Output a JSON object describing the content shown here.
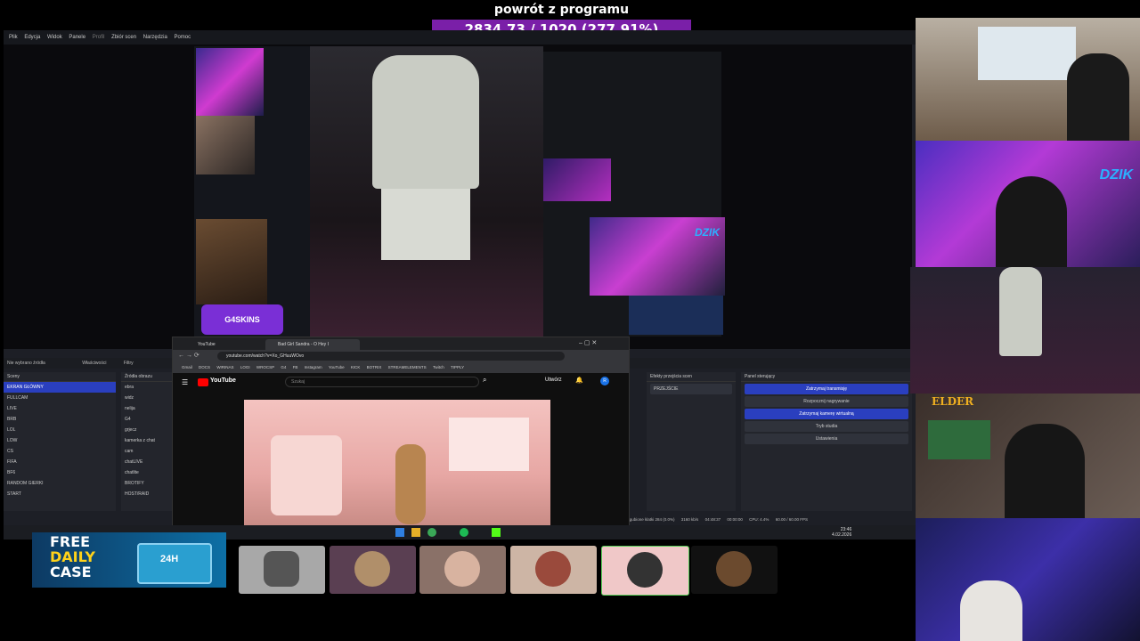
{
  "overlay": {
    "title": "powrót z programu",
    "counter": "2834.73 / 1020 (277.91%)",
    "accent_color": "#7a1fa8"
  },
  "obs": {
    "menu": [
      "Plik",
      "Edycja",
      "Widok",
      "Panele",
      "Profil",
      "Zbiór scen",
      "Narzędzia",
      "Pomoc"
    ],
    "source_info": {
      "no_source": "Nie wybrano źródła",
      "properties": "Właściwości",
      "filters": "Filtry"
    },
    "scenes": {
      "header": "Sceny",
      "items": [
        "EKRAN GŁÓWNY",
        "FULLCAM",
        "LIVE",
        "BRB",
        "LOL",
        "LOW",
        "CS",
        "FIFA",
        "BF6",
        "RANDOM GIERKI",
        "START"
      ],
      "selected": 0
    },
    "sources": {
      "header": "Źródła obrazu",
      "items": [
        "ebra",
        "widz",
        "nelija",
        "G4",
        "grjecz",
        "kamerka z chat",
        "cam",
        "chatLIVE",
        "chatlite",
        "BROTIFY",
        "HOST/RAID"
      ]
    },
    "transitions": {
      "header": "Efekty przejścia scen",
      "value": "PRZEJŚCIE"
    },
    "controls": {
      "header": "Panel sterujący",
      "buttons": [
        "Zatrzymaj transmisję",
        "Rozpocznij nagrywanie",
        "Zatrzymaj kamerę wirtualną",
        "Tryb studia",
        "Ustawienia"
      ]
    },
    "status": {
      "dropped": "Zgubione klatki 284 (0.0%)",
      "bitrate": "3160 kb/s",
      "stream_time": "04:48:37",
      "rec_time": "00:00:00",
      "cpu": "CPU: 4.4%",
      "fps": "60.00 / 60.00 FPS"
    },
    "preview_labels": {
      "brand_purple": "G4SKINS",
      "sponsor": "DZIK"
    }
  },
  "browser": {
    "tabs": [
      "YouTube",
      "Bad Girl Sandra - O Hey I"
    ],
    "url": "youtube.com/watch?v=Xo_GHuuWOvo",
    "bookmarks": [
      "Gmail",
      "DOCS",
      "WIRINAS",
      "LOGI",
      "WROCSP",
      "G4",
      "FB",
      "Instagram",
      "YouTube",
      "KICK",
      "BOTRIX",
      "STREAMELEMENTS",
      "Twitch",
      "TIPPLY"
    ],
    "youtube": {
      "logo": "YouTube",
      "search_placeholder": "Szukaj",
      "create_label": "Utwórz",
      "avatar": "R"
    }
  },
  "taskbar": {
    "time": "23:46",
    "date": "4.02.2026"
  },
  "bottom": {
    "ad_line1": "FREE",
    "ad_line2": "DAILY",
    "ad_line3": "CASE",
    "ad_badge": "24H"
  },
  "right_cams": {
    "label_elder": "ELDER",
    "label_dzik": "DZIK"
  }
}
